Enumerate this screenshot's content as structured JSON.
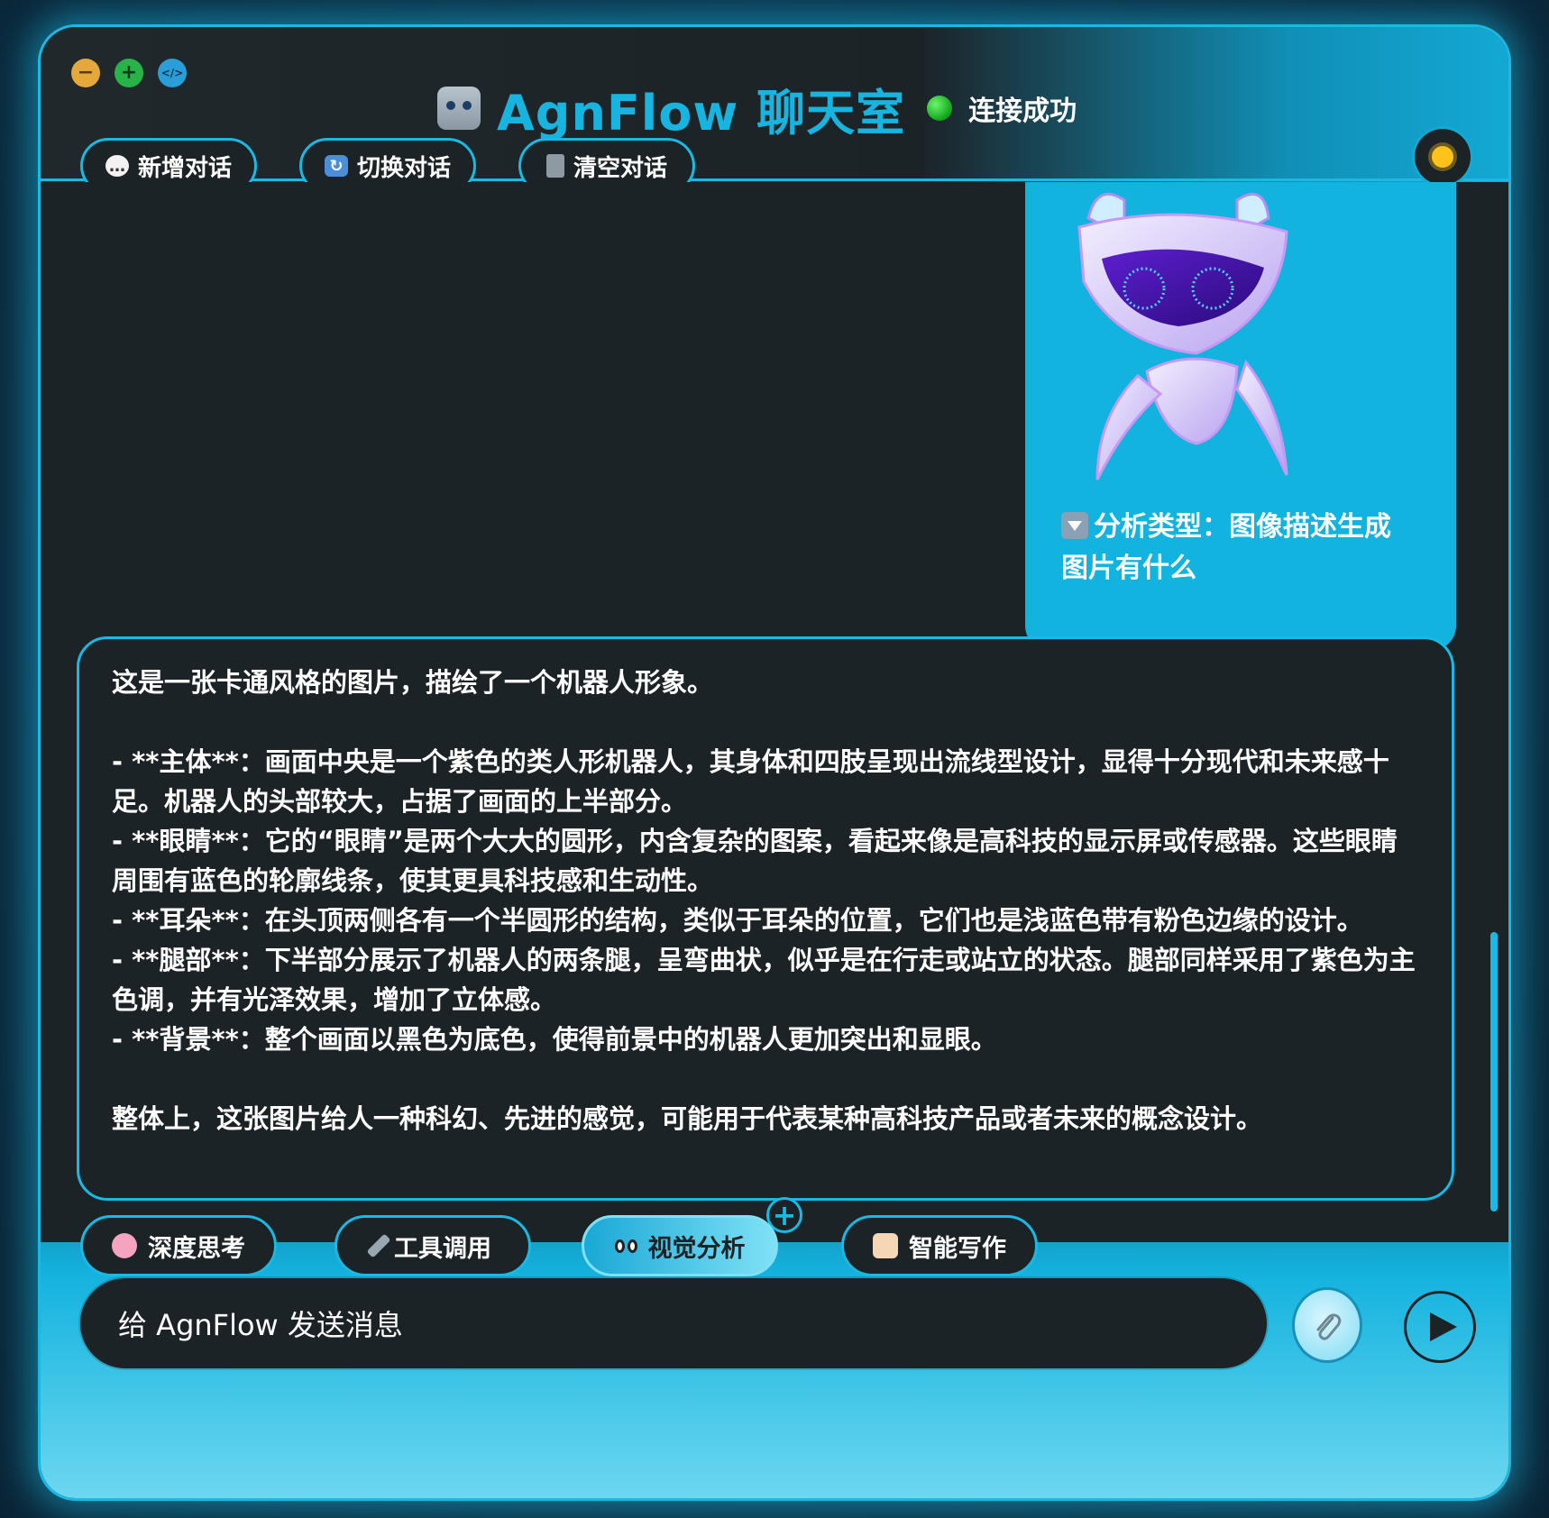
{
  "window": {
    "title": "AgnFlow 聊天室",
    "status": "连接成功",
    "controls": [
      "−",
      "+",
      "</>"
    ]
  },
  "header": {
    "tabs": [
      {
        "icon": "speech-bubble-icon",
        "label": "新增对话"
      },
      {
        "icon": "refresh-icon",
        "label": "切换对话"
      },
      {
        "icon": "trash-icon",
        "label": "清空对话"
      }
    ],
    "theme_icon": "sun-icon"
  },
  "messages": {
    "user": {
      "analysis_label": "分析类型：图像描述生成",
      "question": "图片有什么"
    },
    "assistant": {
      "lines": [
        "这是一张卡通风格的图片，描绘了一个机器人形象。",
        "",
        "- **主体**：画面中央是一个紫色的类人形机器人，其身体和四肢呈现出流线型设计，显得十分现代和未来感十足。机器人的头部较大，占据了画面的上半部分。",
        "- **眼睛**：它的“眼睛”是两个大大的圆形，内含复杂的图案，看起来像是高科技的显示屏或传感器。这些眼睛周围有蓝色的轮廓线条，使其更具科技感和生动性。",
        "- **耳朵**：在头顶两侧各有一个半圆形的结构，类似于耳朵的位置，它们也是浅蓝色带有粉色边缘的设计。",
        "- **腿部**：下半部分展示了机器人的两条腿，呈弯曲状，似乎是在行走或站立的状态。腿部同样采用了紫色为主色调，并有光泽效果，增加了立体感。",
        "- **背景**：整个画面以黑色为底色，使得前景中的机器人更加突出和显眼。",
        "",
        "整体上，这张图片给人一种科幻、先进的感觉，可能用于代表某种高科技产品或者未来的概念设计。"
      ]
    }
  },
  "modes": [
    {
      "icon": "brain-icon",
      "label": "深度思考",
      "active": false
    },
    {
      "icon": "wrench-icon",
      "label": "工具调用",
      "active": false
    },
    {
      "icon": "eyes-icon",
      "label": "视觉分析",
      "active": true
    },
    {
      "icon": "writing-hand-icon",
      "label": "智能写作",
      "active": false
    }
  ],
  "composer": {
    "placeholder": "给 AgnFlow 发送消息"
  },
  "colors": {
    "accent": "#19b9e3",
    "panel": "#1c2327",
    "status_green": "#11a31a"
  }
}
